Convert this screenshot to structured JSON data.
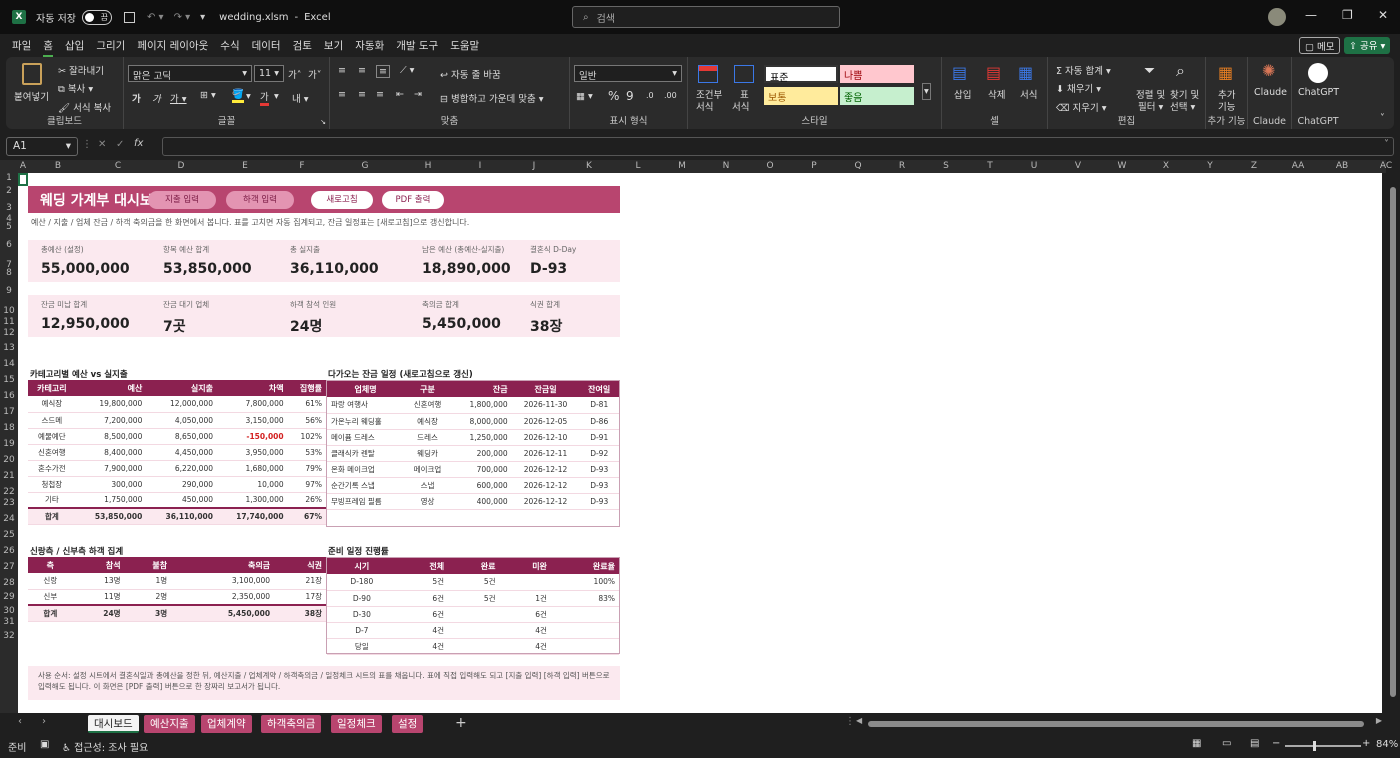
{
  "titlebar": {
    "autosave": "자동 저장",
    "toggle": "끔",
    "filename": "wedding.xlsm",
    "sep": "-",
    "app": "Excel",
    "search_placeholder": "검색"
  },
  "menu": [
    "파일",
    "홈",
    "삽입",
    "그리기",
    "페이지 레이아웃",
    "수식",
    "데이터",
    "검토",
    "보기",
    "자동화",
    "개발 도구",
    "도움말"
  ],
  "menu_right": {
    "memo": "메모",
    "share": "공유"
  },
  "ribbon": {
    "clipboard": {
      "paste": "붙여넣기",
      "cut": "잘라내기",
      "copy": "복사",
      "format_painter": "서식 복사",
      "label": "클립보드"
    },
    "font": {
      "name": "맑은 고딕",
      "size": "11",
      "label": "글꼴",
      "grow": "가",
      "shrink": "가",
      "bold": "가",
      "italic": "가",
      "underline": "가",
      "font_color": "가"
    },
    "align": {
      "wrap": "자동 줄 바꿈",
      "merge": "병합하고 가운데 맞춤",
      "label": "맞춤"
    },
    "number": {
      "format": "일반",
      "label": "표시 형식"
    },
    "styles": {
      "cond": "조건부",
      "cond2": "서식",
      "table": "표",
      "table2": "서식",
      "normal": "표준",
      "bad": "나쁨",
      "neutral": "보통",
      "good": "좋음",
      "label": "스타일"
    },
    "cells": {
      "insert": "삽입",
      "delete": "삭제",
      "format": "서식",
      "label": "셀"
    },
    "edit": {
      "autosum": "자동 합계",
      "fill": "채우기",
      "clear": "지우기",
      "sort": "정렬 및",
      "sort2": "필터",
      "find": "찾기 및",
      "find2": "선택",
      "label": "편집"
    },
    "addins": {
      "btn": "추가",
      "btn2": "기능",
      "label": "추가 기능"
    },
    "claude": {
      "btn": "Claude",
      "label": "Claude"
    },
    "chatgpt": {
      "btn": "ChatGPT",
      "label": "ChatGPT"
    }
  },
  "namebox": "A1",
  "fx": "fx",
  "cols": [
    "A",
    "B",
    "C",
    "D",
    "E",
    "F",
    "G",
    "H",
    "I",
    "J",
    "K",
    "L",
    "M",
    "N",
    "O",
    "P",
    "Q",
    "R",
    "S",
    "T",
    "U",
    "V",
    "W",
    "X",
    "Y",
    "Z",
    "AA",
    "AB",
    "AC"
  ],
  "rows": [
    "1",
    "2",
    "3",
    "4",
    "5",
    "6",
    "7",
    "8",
    "9",
    "10",
    "11",
    "12",
    "13",
    "14",
    "15",
    "16",
    "17",
    "18",
    "19",
    "20",
    "21",
    "22",
    "23",
    "24",
    "25",
    "26",
    "27",
    "28",
    "29",
    "30",
    "31",
    "32"
  ],
  "dash": {
    "title": "웨딩 가계부 대시보드",
    "buttons": [
      "지출 입력",
      "하객 입력",
      "새로고침",
      "PDF 출력"
    ],
    "subtitle": "예산 / 지출 / 업체 잔금 / 하객 축의금을 한 화면에서 봅니다. 표를 고치면 자동 집계되고, 잔금 일정표는 [새로고침]으로 갱신합니다.",
    "kpi1": [
      {
        "label": "총예산 (설정)",
        "value": "55,000,000"
      },
      {
        "label": "항목 예산 합계",
        "value": "53,850,000"
      },
      {
        "label": "총 실지출",
        "value": "36,110,000"
      },
      {
        "label": "남은 예산 (총예산-실지출)",
        "value": "18,890,000"
      },
      {
        "label": "결혼식 D-Day",
        "value": "D-93"
      }
    ],
    "kpi2": [
      {
        "label": "잔금 미납 합계",
        "value": "12,950,000"
      },
      {
        "label": "잔금 대기 업체",
        "value": "7곳"
      },
      {
        "label": "하객 참석 인원",
        "value": "24명"
      },
      {
        "label": "축의금 합계",
        "value": "5,450,000"
      },
      {
        "label": "식권 합계",
        "value": "38장"
      }
    ],
    "budget": {
      "title": "카테고리별 예산 vs 실지출",
      "headers": [
        "카테고리",
        "예산",
        "실지출",
        "차액",
        "집행률"
      ],
      "rows": [
        [
          "예식장",
          "19,800,000",
          "12,000,000",
          "7,800,000",
          "61%"
        ],
        [
          "스드메",
          "7,200,000",
          "4,050,000",
          "3,150,000",
          "56%"
        ],
        [
          "예물예단",
          "8,500,000",
          "8,650,000",
          "-150,000",
          "102%"
        ],
        [
          "신혼여행",
          "8,400,000",
          "4,450,000",
          "3,950,000",
          "53%"
        ],
        [
          "혼수가전",
          "7,900,000",
          "6,220,000",
          "1,680,000",
          "79%"
        ],
        [
          "청첩장",
          "300,000",
          "290,000",
          "10,000",
          "97%"
        ],
        [
          "기타",
          "1,750,000",
          "450,000",
          "1,300,000",
          "26%"
        ]
      ],
      "total": [
        "합계",
        "53,850,000",
        "36,110,000",
        "17,740,000",
        "67%"
      ]
    },
    "balance": {
      "title": "다가오는 잔금 일정 (새로고침으로 갱신)",
      "headers": [
        "업체명",
        "구분",
        "잔금",
        "잔금일",
        "잔여일"
      ],
      "rows": [
        [
          "파랑 여행사",
          "신혼여행",
          "1,800,000",
          "2026-11-30",
          "D-81"
        ],
        [
          "가온누리 웨딩홀",
          "예식장",
          "8,000,000",
          "2026-12-05",
          "D-86"
        ],
        [
          "메이퓸 드레스",
          "드레스",
          "1,250,000",
          "2026-12-10",
          "D-91"
        ],
        [
          "클래식카 렌탈",
          "웨딩카",
          "200,000",
          "2026-12-11",
          "D-92"
        ],
        [
          "온화 메이크업",
          "메이크업",
          "700,000",
          "2026-12-12",
          "D-93"
        ],
        [
          "순간기록 스냅",
          "스냅",
          "600,000",
          "2026-12-12",
          "D-93"
        ],
        [
          "무빙프레임 필름",
          "영상",
          "400,000",
          "2026-12-12",
          "D-93"
        ]
      ]
    },
    "guests": {
      "title": "신랑측 / 신부측 하객 집계",
      "headers": [
        "측",
        "참석",
        "불참",
        "축의금",
        "식권"
      ],
      "rows": [
        [
          "신랑",
          "13명",
          "1명",
          "3,100,000",
          "21장"
        ],
        [
          "신부",
          "11명",
          "2명",
          "2,350,000",
          "17장"
        ]
      ],
      "total": [
        "합계",
        "24명",
        "3명",
        "5,450,000",
        "38장"
      ]
    },
    "progress": {
      "title": "준비 일정 진행률",
      "headers": [
        "시기",
        "전체",
        "완료",
        "미완",
        "완료율"
      ],
      "rows": [
        [
          "D-180",
          "5건",
          "5건",
          "",
          "100%"
        ],
        [
          "D-90",
          "6건",
          "5건",
          "1건",
          "83%"
        ],
        [
          "D-30",
          "6건",
          "",
          "6건",
          ""
        ],
        [
          "D-7",
          "4건",
          "",
          "4건",
          ""
        ],
        [
          "당일",
          "4건",
          "",
          "4건",
          ""
        ]
      ]
    },
    "note": "사용 순서: 설정 시트에서 결혼식일과 총예산을 정한 뒤, 예산지출 / 업체계약 / 하객축의금 / 일정체크 시트의 표를 채웁니다. 표에 직접 입력해도 되고 [지출 입력] [하객 입력] 버튼으로 입력해도 됩니다. 이 화면은 [PDF 출력] 버튼으로 한 장짜리 보고서가 됩니다."
  },
  "tabs": [
    "대시보드",
    "예산지출",
    "업체계약",
    "하객축의금",
    "일정체크",
    "설정"
  ],
  "status": {
    "ready": "준비",
    "access": "접근성: 조사 필요",
    "zoom": "84%"
  },
  "colors": {
    "accent": "#b8456f",
    "header": "#8b2150",
    "band": "#fbe9ef",
    "excel_green": "#1e7145"
  }
}
